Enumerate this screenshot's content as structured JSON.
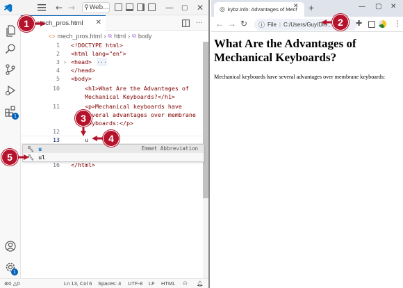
{
  "vscode": {
    "search_label": "Web...",
    "tab_label": "mech_pros.html",
    "breadcrumb": {
      "file": "mech_pros.html",
      "html": "html",
      "body": "body"
    },
    "lines": [
      {
        "n": "1",
        "text": "<!DOCTYPE html>"
      },
      {
        "n": "2",
        "text": "<html lang=\"en\">"
      },
      {
        "n": "3",
        "text": "<head>"
      },
      {
        "n": "4",
        "text": "</head>"
      },
      {
        "n": "5",
        "text": "<body>"
      },
      {
        "n": "10",
        "text": "<h1>What Are the Advantages of"
      },
      {
        "n": "",
        "text": "Mechanical Keyboards?</h1>"
      },
      {
        "n": "11",
        "text": "<p>Mechanical keyboards have"
      },
      {
        "n": "",
        "text": "several advantages over membrane"
      },
      {
        "n": "",
        "text": "keyboards:</p>"
      },
      {
        "n": "12",
        "text": ""
      },
      {
        "n": "13",
        "text": "u"
      },
      {
        "n": "16",
        "text": "</html>"
      }
    ],
    "suggest": {
      "item1": "u",
      "item1_detail": "Emmet Abbreviation",
      "item2": "ul"
    },
    "status": {
      "problems": "0",
      "warnings": "0",
      "position": "Ln 13, Col 6",
      "spaces": "Spaces: 4",
      "encoding": "UTF-8",
      "eol": "LF",
      "language": "HTML"
    }
  },
  "chrome": {
    "tab_title": "kybz.info: Advantages of Mecha",
    "omnibox_scheme": "File",
    "omnibox_path": "C:/Users/Guy/Dro...",
    "page_heading": "What Are the Advantages of Mechanical Keyboards?",
    "page_paragraph": "Mechanical keyboards have several advantages over membrane keyboards:"
  },
  "callouts": [
    "1",
    "2",
    "3",
    "4",
    "5"
  ],
  "colors": {
    "callout": "#b5122b",
    "accent": "#005fb8"
  }
}
